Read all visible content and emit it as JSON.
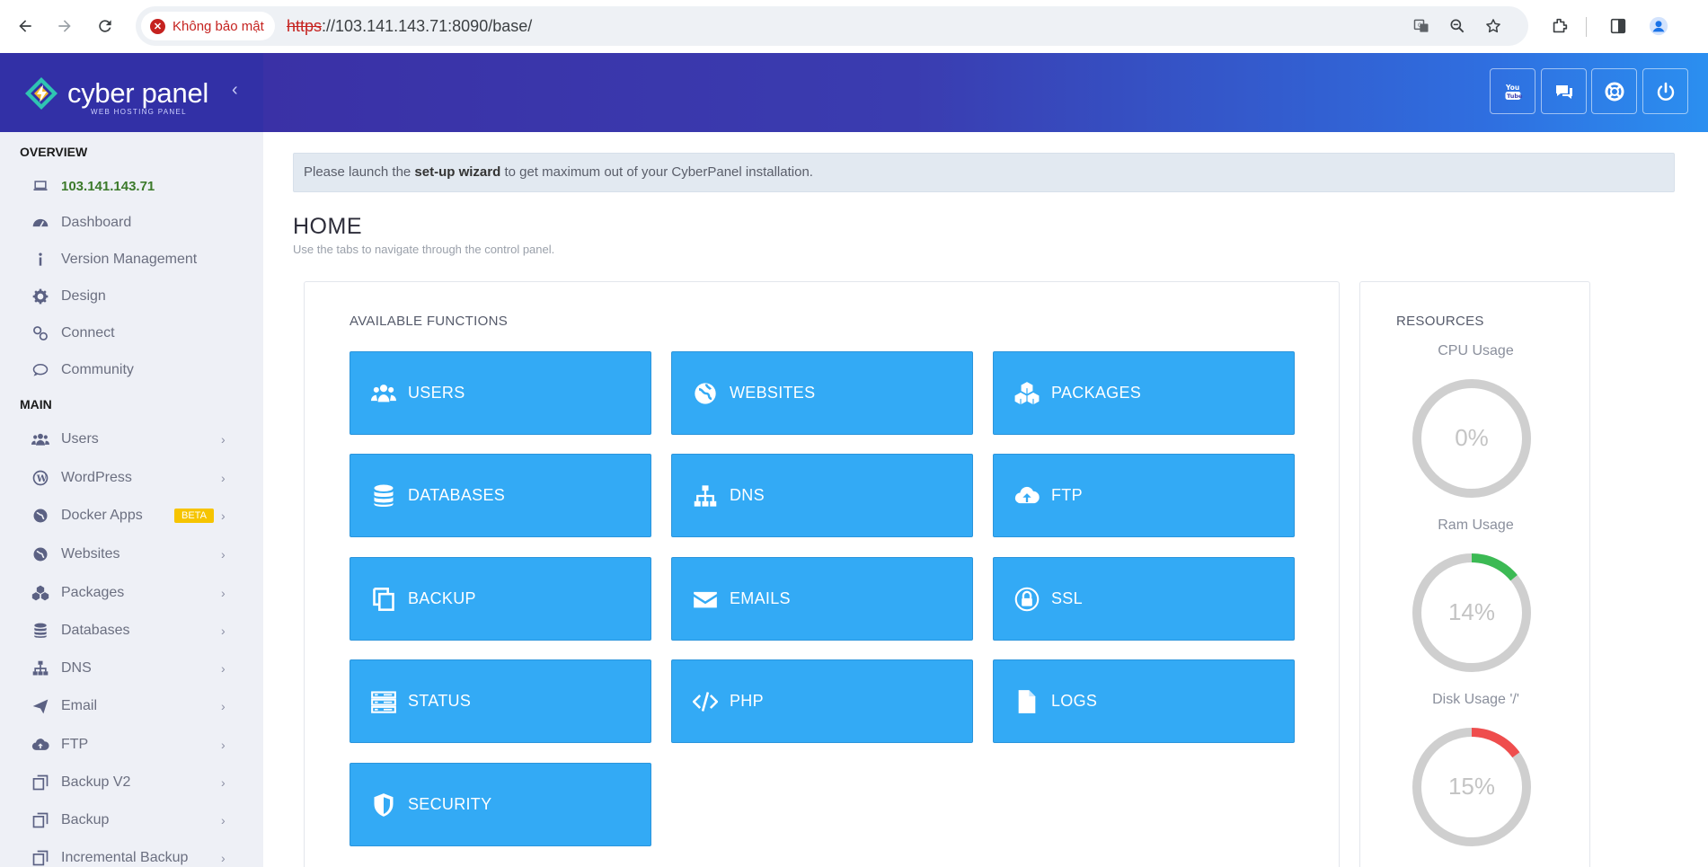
{
  "browser": {
    "security_label": "Không bảo mật",
    "url_scheme": "https",
    "url_rest": "://103.141.143.71:8090/base/"
  },
  "header": {
    "logo_text": "cyber panel",
    "logo_subtext": "WEB HOSTING PANEL",
    "buttons": [
      "youtube-icon",
      "chat-icon",
      "support-icon",
      "power-icon"
    ]
  },
  "sidebar": {
    "overview_title": "OVERVIEW",
    "overview_items": [
      {
        "label": "103.141.143.71",
        "icon": "laptop-icon"
      },
      {
        "label": "Dashboard",
        "icon": "dashboard-icon"
      },
      {
        "label": "Version Management",
        "icon": "info-icon"
      },
      {
        "label": "Design",
        "icon": "gear-icon"
      },
      {
        "label": "Connect",
        "icon": "link-icon"
      },
      {
        "label": "Community",
        "icon": "chat-icon"
      }
    ],
    "main_title": "MAIN",
    "main_items": [
      {
        "label": "Users",
        "icon": "users-icon"
      },
      {
        "label": "WordPress",
        "icon": "wordpress-icon"
      },
      {
        "label": "Docker Apps",
        "icon": "globe-icon",
        "badge": "BETA"
      },
      {
        "label": "Websites",
        "icon": "globe-icon"
      },
      {
        "label": "Packages",
        "icon": "cubes-icon"
      },
      {
        "label": "Databases",
        "icon": "database-icon"
      },
      {
        "label": "DNS",
        "icon": "sitemap-icon"
      },
      {
        "label": "Email",
        "icon": "paper-plane-icon"
      },
      {
        "label": "FTP",
        "icon": "cloud-upload-icon"
      },
      {
        "label": "Backup V2",
        "icon": "backup-icon"
      },
      {
        "label": "Backup",
        "icon": "backup-icon"
      },
      {
        "label": "Incremental Backup",
        "icon": "backup-icon"
      }
    ]
  },
  "main": {
    "notice_pre": "Please launch the ",
    "notice_bold": "set-up wizard",
    "notice_post": " to get maximum out of your CyberPanel installation.",
    "title": "HOME",
    "subtitle": "Use the tabs to navigate through the control panel.",
    "functions_title": "AVAILABLE FUNCTIONS",
    "functions": [
      {
        "label": "USERS",
        "icon": "users-icon"
      },
      {
        "label": "WEBSITES",
        "icon": "globe-icon"
      },
      {
        "label": "PACKAGES",
        "icon": "cubes-icon"
      },
      {
        "label": "DATABASES",
        "icon": "database-icon"
      },
      {
        "label": "DNS",
        "icon": "sitemap-icon"
      },
      {
        "label": "FTP",
        "icon": "cloud-upload-icon"
      },
      {
        "label": "BACKUP",
        "icon": "copy-icon"
      },
      {
        "label": "EMAILS",
        "icon": "envelope-icon"
      },
      {
        "label": "SSL",
        "icon": "lock-icon"
      },
      {
        "label": "STATUS",
        "icon": "server-icon"
      },
      {
        "label": "PHP",
        "icon": "code-icon"
      },
      {
        "label": "LOGS",
        "icon": "file-icon"
      },
      {
        "label": "SECURITY",
        "icon": "shield-icon"
      }
    ],
    "resources_title": "RESOURCES",
    "resources": [
      {
        "label": "CPU Usage",
        "value": "0%",
        "percent": 0,
        "color": "#cccccc"
      },
      {
        "label": "Ram Usage",
        "value": "14%",
        "percent": 14,
        "color": "#3cba54"
      },
      {
        "label": "Disk Usage '/'",
        "value": "15%",
        "percent": 15,
        "color": "#ef4d4d"
      }
    ]
  },
  "colors": {
    "header_left": "#3230a6",
    "header_right": "#2b8ff0",
    "function_button": "#33aaf5",
    "sidebar_bg": "#eef0f6"
  }
}
